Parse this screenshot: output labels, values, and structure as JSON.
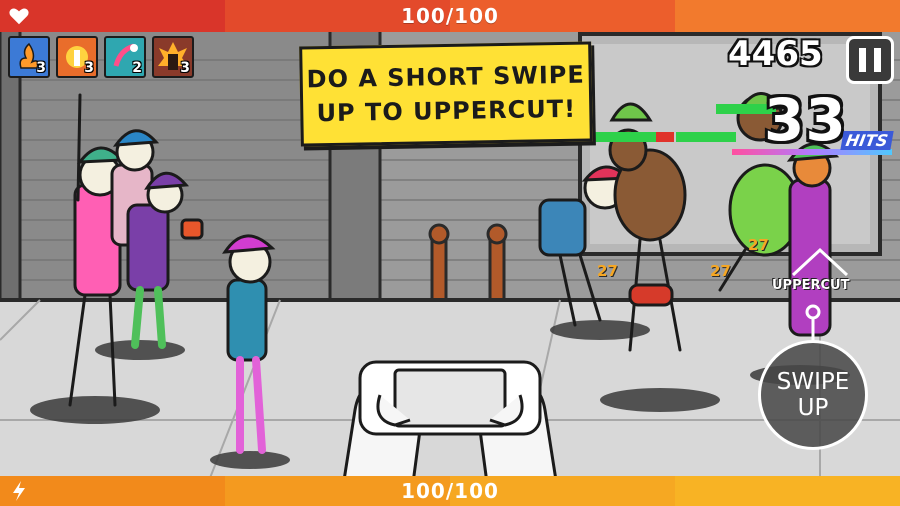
{
  "health": {
    "label": "100/100",
    "icon": "heart-icon"
  },
  "energy": {
    "label": "100/100",
    "icon": "lightning-icon"
  },
  "powerups": [
    {
      "icon": "fire-burst-icon",
      "count": "3",
      "color": "#3c7ad6"
    },
    {
      "icon": "explosion-icon",
      "count": "3",
      "color": "#e96d2b"
    },
    {
      "icon": "magnet-icon",
      "count": "2",
      "color": "#2fa7b0"
    },
    {
      "icon": "rage-icon",
      "count": "3",
      "color": "#8a3a2a"
    }
  ],
  "score": "4465",
  "combo": {
    "count": "33",
    "label": "HITS"
  },
  "tutorial": {
    "line1": "DO A SHORT SWIPE",
    "line2": "UP TO UPPERCUT!"
  },
  "gesture": {
    "label": "UPPERCUT",
    "line1": "SWIPE",
    "line2": "UP"
  },
  "damage": [
    "27",
    "27",
    "27"
  ],
  "colors": {
    "health_dark": "#d9352a",
    "health_light": "#f06e2c",
    "energy_dark": "#f28a1b",
    "energy_light": "#f8b324",
    "sign": "#ffe135"
  }
}
